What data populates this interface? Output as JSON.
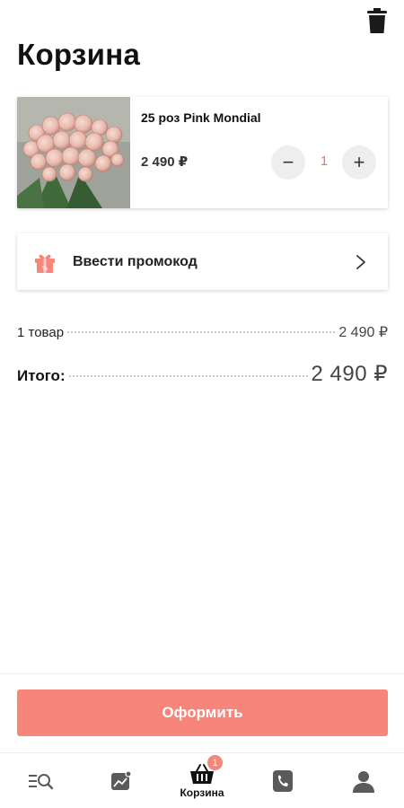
{
  "header": {
    "title": "Корзина"
  },
  "cart": {
    "items": [
      {
        "name": "25 роз Pink Mondial",
        "price": "2 490 ₽",
        "quantity": "1",
        "decrement_label": "−",
        "increment_label": "+"
      }
    ]
  },
  "promo": {
    "label": "Ввести промокод"
  },
  "summary": {
    "items_label": "1 товар",
    "items_amount": "2 490 ₽",
    "total_label": "Итого:",
    "total_amount": "2 490 ₽"
  },
  "checkout": {
    "label": "Оформить"
  },
  "tabbar": {
    "tabs": [
      {
        "icon": "catalog-search-icon",
        "label": ""
      },
      {
        "icon": "picture-icon",
        "label": ""
      },
      {
        "icon": "basket-icon",
        "label": "Корзина",
        "badge": "1"
      },
      {
        "icon": "phone-icon",
        "label": ""
      },
      {
        "icon": "user-icon",
        "label": ""
      }
    ]
  },
  "colors": {
    "accent": "#f7857a",
    "quantity": "#f2716a",
    "icon_gray": "#5a5a5a"
  }
}
